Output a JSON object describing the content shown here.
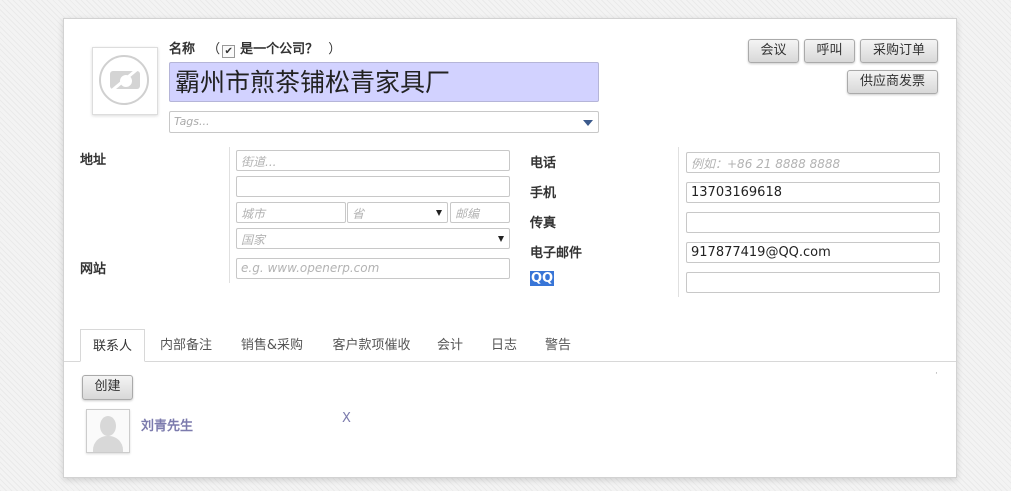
{
  "header": {
    "name_label": "名称",
    "is_company_open": "（",
    "is_company_label": "是一个公司？",
    "is_company_close": "）",
    "company_name": "霸州市煎茶铺松青家具厂",
    "tags_placeholder": "Tags..."
  },
  "buttons": {
    "meeting": "会议",
    "call": "呼叫",
    "purchase_order": "采购订单",
    "supplier_invoice": "供应商发票"
  },
  "address": {
    "label": "地址",
    "street_placeholder": "街道...",
    "street2_value": "",
    "city_placeholder": "城市",
    "state_placeholder": "省",
    "zip_placeholder": "邮编",
    "country_placeholder": "国家"
  },
  "website": {
    "label": "网站",
    "placeholder": "e.g. www.openerp.com"
  },
  "contact": {
    "phone_label": "电话",
    "phone_placeholder": "例如：+86 21 8888 8888",
    "mobile_label": "手机",
    "mobile_value": "13703169618",
    "fax_label": "传真",
    "fax_value": "",
    "email_label": "电子邮件",
    "email_value": "917877419@QQ.com",
    "qq_label": "QQ",
    "qq_value": ""
  },
  "tabs": [
    {
      "label": "联系人",
      "active": true
    },
    {
      "label": "内部备注"
    },
    {
      "label": "销售&采购"
    },
    {
      "label": "客户款项催收"
    },
    {
      "label": "会计"
    },
    {
      "label": "日志"
    },
    {
      "label": "警告"
    }
  ],
  "contacts_tab": {
    "create_button": "创建",
    "contacts": [
      {
        "name": "刘青先生",
        "remove": "X"
      }
    ]
  },
  "colors": {
    "name_highlight": "#d2d2ff",
    "link": "#7c7bad",
    "qq_highlight": "#3875d7"
  }
}
